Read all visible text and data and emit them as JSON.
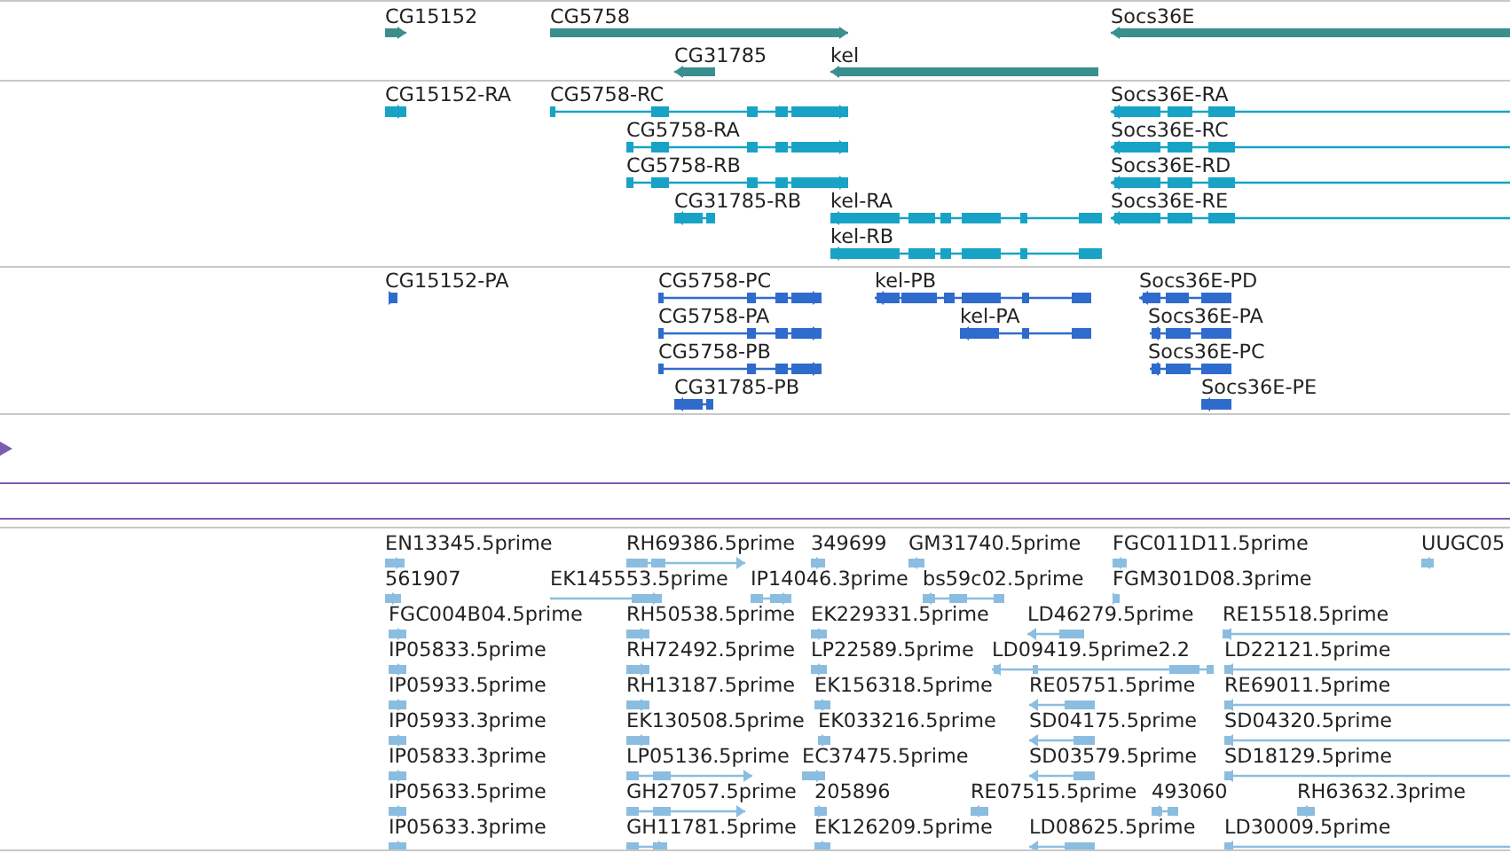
{
  "tracks": [
    {
      "kind": "gene",
      "features": [
        {
          "label": "CG15152",
          "reverse": false
        },
        {
          "label": "CG5758",
          "reverse": false
        },
        {
          "label": "Socs36E",
          "reverse": true
        },
        {
          "label": "CG31785",
          "reverse": true
        },
        {
          "label": "kel",
          "reverse": true
        }
      ]
    },
    {
      "kind": "transcript",
      "features": [
        {
          "label": "CG15152-RA",
          "reverse": false
        },
        {
          "label": "CG5758-RC",
          "reverse": false
        },
        {
          "label": "CG5758-RA",
          "reverse": false
        },
        {
          "label": "CG5758-RB",
          "reverse": false
        },
        {
          "label": "CG31785-RB",
          "reverse": true
        },
        {
          "label": "kel-RA",
          "reverse": true
        },
        {
          "label": "kel-RB",
          "reverse": true
        },
        {
          "label": "Socs36E-RA",
          "reverse": true
        },
        {
          "label": "Socs36E-RC",
          "reverse": true
        },
        {
          "label": "Socs36E-RD",
          "reverse": true
        },
        {
          "label": "Socs36E-RE",
          "reverse": true
        }
      ]
    },
    {
      "kind": "protein",
      "features": [
        {
          "label": "CG15152-PA",
          "reverse": false
        },
        {
          "label": "CG5758-PC",
          "reverse": false
        },
        {
          "label": "CG5758-PA",
          "reverse": false
        },
        {
          "label": "CG5758-PB",
          "reverse": false
        },
        {
          "label": "CG31785-PB",
          "reverse": true
        },
        {
          "label": "kel-PB",
          "reverse": true
        },
        {
          "label": "kel-PA",
          "reverse": true
        },
        {
          "label": "Socs36E-PD",
          "reverse": true
        },
        {
          "label": "Socs36E-PA",
          "reverse": true
        },
        {
          "label": "Socs36E-PC",
          "reverse": true
        },
        {
          "label": "Socs36E-PE",
          "reverse": true
        }
      ]
    },
    {
      "kind": "signal"
    },
    {
      "kind": "est",
      "features": [
        {
          "label": "EN13345.5prime",
          "reverse": false
        },
        {
          "label": "RH69386.5prime",
          "reverse": false
        },
        {
          "label": "349699",
          "reverse": false
        },
        {
          "label": "GM31740.5prime",
          "reverse": true
        },
        {
          "label": "FGC011D11.5prime",
          "reverse": true
        },
        {
          "label": "UUGC05",
          "reverse": true
        },
        {
          "label": "561907",
          "reverse": false
        },
        {
          "label": "EK145553.5prime",
          "reverse": false
        },
        {
          "label": "IP14046.3prime",
          "reverse": false
        },
        {
          "label": "bs59c02.5prime",
          "reverse": true
        },
        {
          "label": "FGM301D08.3prime",
          "reverse": false
        },
        {
          "label": "FGC004B04.5prime",
          "reverse": false
        },
        {
          "label": "RH50538.5prime",
          "reverse": false
        },
        {
          "label": "EK229331.5prime",
          "reverse": false
        },
        {
          "label": "LD46279.5prime",
          "reverse": true
        },
        {
          "label": "RE15518.5prime",
          "reverse": true
        },
        {
          "label": "IP05833.5prime",
          "reverse": false
        },
        {
          "label": "RH72492.5prime",
          "reverse": false
        },
        {
          "label": "LP22589.5prime",
          "reverse": false
        },
        {
          "label": "LD09419.5prime2.2",
          "reverse": true
        },
        {
          "label": "LD22121.5prime",
          "reverse": true
        },
        {
          "label": "IP05933.5prime",
          "reverse": false
        },
        {
          "label": "RH13187.5prime",
          "reverse": false
        },
        {
          "label": "EK156318.5prime",
          "reverse": false
        },
        {
          "label": "RE05751.5prime",
          "reverse": true
        },
        {
          "label": "RE69011.5prime",
          "reverse": true
        },
        {
          "label": "IP05933.3prime",
          "reverse": false
        },
        {
          "label": "EK130508.5prime",
          "reverse": false
        },
        {
          "label": "EK033216.5prime",
          "reverse": false
        },
        {
          "label": "SD04175.5prime",
          "reverse": true
        },
        {
          "label": "SD04320.5prime",
          "reverse": true
        },
        {
          "label": "IP05833.3prime",
          "reverse": false
        },
        {
          "label": "LP05136.5prime",
          "reverse": false
        },
        {
          "label": "EC37475.5prime",
          "reverse": false
        },
        {
          "label": "SD03579.5prime",
          "reverse": true
        },
        {
          "label": "SD18129.5prime",
          "reverse": true
        },
        {
          "label": "IP05633.5prime",
          "reverse": false
        },
        {
          "label": "GH27057.5prime",
          "reverse": false
        },
        {
          "label": "205896",
          "reverse": false
        },
        {
          "label": "RE07515.5prime",
          "reverse": true
        },
        {
          "label": "493060",
          "reverse": true
        },
        {
          "label": "RH63632.3prime",
          "reverse": false
        },
        {
          "label": "IP05633.3prime",
          "reverse": false
        },
        {
          "label": "GH11781.5prime",
          "reverse": false
        },
        {
          "label": "EK126209.5prime",
          "reverse": false
        },
        {
          "label": "LD08625.5prime",
          "reverse": true
        },
        {
          "label": "LD30009.5prime",
          "reverse": true
        }
      ]
    }
  ]
}
